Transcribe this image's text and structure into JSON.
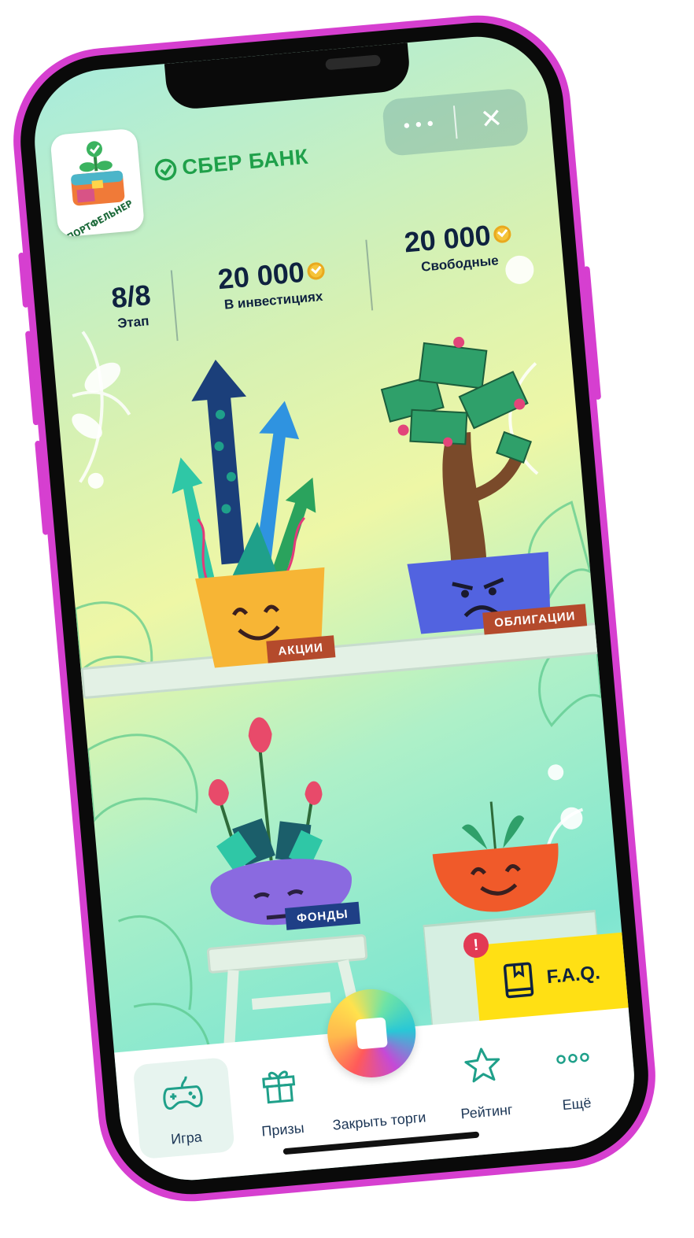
{
  "header": {
    "app_logo_text": "ПОРТФЕЛЬНЕР",
    "brand_name": "СБЕР БАНК",
    "more_glyph": "•••",
    "close_glyph": "✕"
  },
  "stats": {
    "stage_value": "8/8",
    "stage_label": "Этап",
    "invested_value": "20 000",
    "invested_label": "В инвестициях",
    "free_value": "20 000",
    "free_label": "Свободные"
  },
  "plants": {
    "stocks_label": "АКЦИИ",
    "bonds_label": "ОБЛИГАЦИИ",
    "funds_label": "ФОНДЫ"
  },
  "faq": {
    "label": "F.A.Q.",
    "badge": "!"
  },
  "tabbar": {
    "tabs": [
      {
        "label": "Игра",
        "icon": "gamepad-icon",
        "active": true
      },
      {
        "label": "Призы",
        "icon": "gift-icon",
        "active": false
      },
      {
        "label": "Закрыть торги",
        "icon": "stop-icon",
        "active": false
      },
      {
        "label": "Рейтинг",
        "icon": "star-icon",
        "active": false
      },
      {
        "label": "Ещё",
        "icon": "more-dots-icon",
        "active": false
      }
    ]
  },
  "colors": {
    "phone_frame": "#d63fd0",
    "brand_green": "#1fa04a",
    "text_dark": "#0f2240",
    "faq_yellow": "#ffe014",
    "label_brown": "#b44a2c",
    "label_navy": "#1f3f86"
  }
}
